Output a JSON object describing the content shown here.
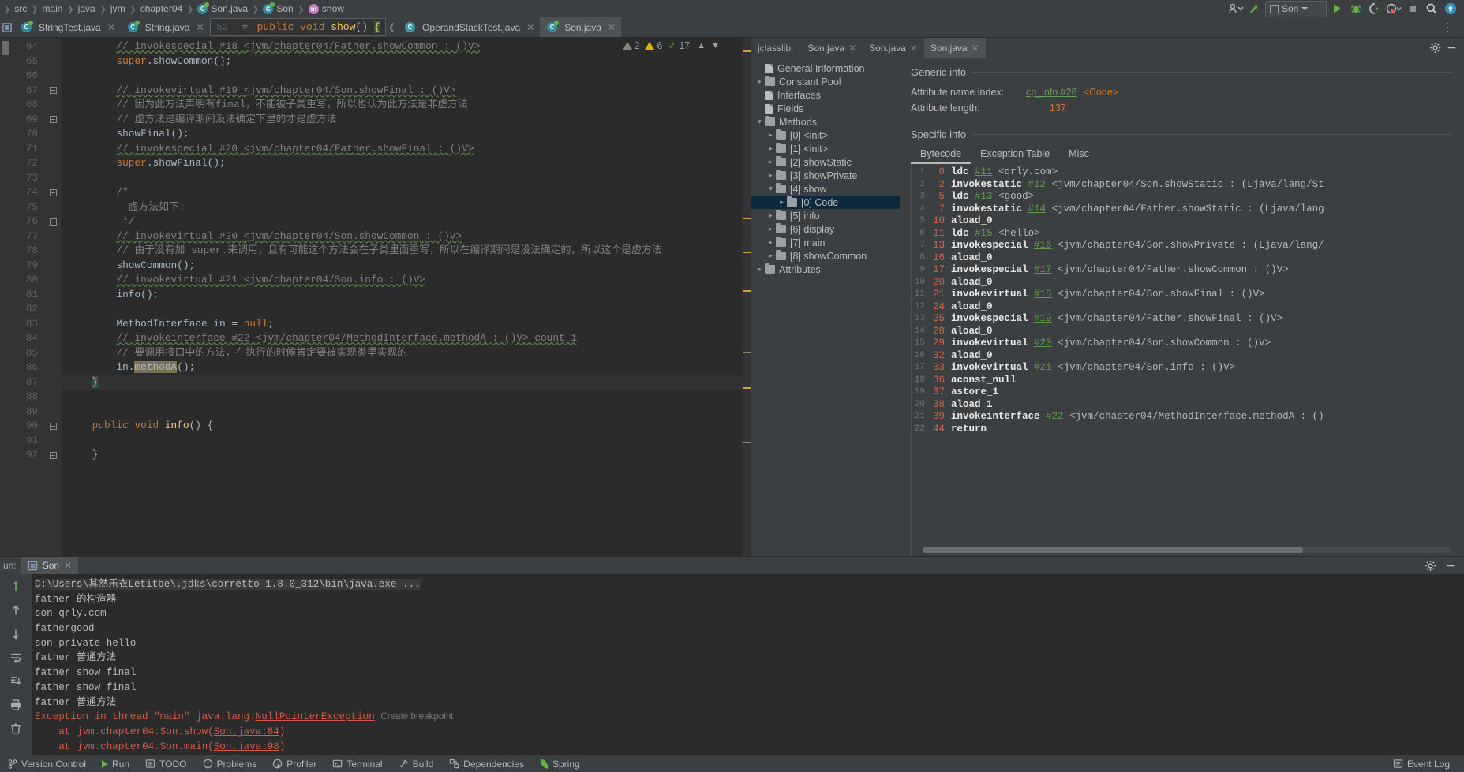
{
  "navbar": {
    "breadcrumbs": [
      {
        "label": "src",
        "icon": "none"
      },
      {
        "label": "main",
        "icon": "none"
      },
      {
        "label": "java",
        "icon": "none"
      },
      {
        "label": "jvm",
        "icon": "none"
      },
      {
        "label": "chapter04",
        "icon": "none"
      },
      {
        "label": "Son.java",
        "icon": "class-icon"
      },
      {
        "label": "Son",
        "icon": "class-icon"
      },
      {
        "label": "show",
        "icon": "method-icon"
      }
    ],
    "run_config": "Son",
    "buttons": {
      "profile": "user-dropdown-icon",
      "updates": "update-arrow-icon",
      "run": "run-icon",
      "debug": "debug-icon",
      "coverage": "run-with-coverage-icon",
      "profiler": "profiler-icon",
      "stop": "stop-icon",
      "search": "search-icon",
      "notifications": "notifications-icon"
    }
  },
  "editor": {
    "tabs": [
      {
        "label": "StringTest.java",
        "icon": "java-class-icon",
        "active": false,
        "closable": true
      },
      {
        "label": "String.java",
        "icon": "java-class-icon",
        "active": false,
        "closable": true
      },
      {
        "label": "OperandStackTest.java",
        "icon": "java-interface-icon",
        "active": false,
        "closable": true
      },
      {
        "label": "Son.java",
        "icon": "java-class-icon",
        "active": true,
        "closable": true
      }
    ],
    "breadcrumb_inline": {
      "line_number": "52",
      "signature_prefix": "public void show() ",
      "signature_brace": "{"
    },
    "inspections": {
      "gray_count": "2",
      "warn_count": "6",
      "ok_count": "17",
      "up_arrow": "chevron-up-icon",
      "down_arrow": "chevron-down-icon"
    },
    "first_line": 64,
    "current_line": 87,
    "lines": [
      {
        "n": 64,
        "fold": "",
        "tokens": [
          {
            "t": "comment-wavy",
            "s": "// invokespecial #18 <jvm/chapter04/Father.showCommon : ()V>",
            "indent": 8
          }
        ]
      },
      {
        "n": 65,
        "fold": "",
        "tokens": [
          {
            "t": "kw",
            "s": "super",
            "indent": 8
          },
          {
            "t": "plain",
            "s": ".showCommon();"
          }
        ]
      },
      {
        "n": 66,
        "fold": "",
        "tokens": []
      },
      {
        "n": 67,
        "fold": "fold-open",
        "tokens": [
          {
            "t": "comment-wavy",
            "s": "// invokevirtual #19 <jvm/chapter04/Son.showFinal : ()V>",
            "indent": 8
          }
        ]
      },
      {
        "n": 68,
        "fold": "",
        "tokens": [
          {
            "t": "comment",
            "s": "// 因为此方法声明有final，不能被子类重写，所以也认为此方法是非虚方法",
            "indent": 8
          }
        ]
      },
      {
        "n": 69,
        "fold": "fold-close",
        "tokens": [
          {
            "t": "comment",
            "s": "// 虚方法是编译期间没法确定下里的才是虚方法",
            "indent": 8
          }
        ]
      },
      {
        "n": 70,
        "fold": "",
        "tokens": [
          {
            "t": "plain",
            "s": "showFinal();",
            "indent": 8
          }
        ]
      },
      {
        "n": 71,
        "fold": "",
        "tokens": [
          {
            "t": "comment-wavy",
            "s": "// invokespecial #20 <jvm/chapter04/Father.showFinal : ()V>",
            "indent": 8
          }
        ]
      },
      {
        "n": 72,
        "fold": "",
        "tokens": [
          {
            "t": "kw",
            "s": "super",
            "indent": 8
          },
          {
            "t": "plain",
            "s": ".showFinal();"
          }
        ]
      },
      {
        "n": 73,
        "fold": "",
        "tokens": []
      },
      {
        "n": 74,
        "fold": "fold-open",
        "tokens": [
          {
            "t": "comment",
            "s": "/*",
            "indent": 8
          }
        ]
      },
      {
        "n": 75,
        "fold": "",
        "tokens": [
          {
            "t": "comment",
            "s": "  虚方法如下:",
            "indent": 8
          }
        ]
      },
      {
        "n": 76,
        "fold": "fold-close",
        "tokens": [
          {
            "t": "comment",
            "s": " */",
            "indent": 8
          }
        ]
      },
      {
        "n": 77,
        "fold": "",
        "tokens": [
          {
            "t": "comment-wavy",
            "s": "// invokevirtual #20 <jvm/chapter04/Son.showCommon : ()V>",
            "indent": 8
          }
        ]
      },
      {
        "n": 78,
        "fold": "",
        "tokens": [
          {
            "t": "comment",
            "s": "// 由于没有加 super.来调用，且有可能这个方法会在子类里面重写，所以在编译期间是没法确定的，所以这个是虚方法",
            "indent": 8
          }
        ]
      },
      {
        "n": 79,
        "fold": "",
        "tokens": [
          {
            "t": "plain",
            "s": "showCommon();",
            "indent": 8
          }
        ]
      },
      {
        "n": 80,
        "fold": "",
        "tokens": [
          {
            "t": "comment-wavy",
            "s": "// invokevirtual #21 <jvm/chapter04/Son.info : ()V>",
            "indent": 8
          }
        ]
      },
      {
        "n": 81,
        "fold": "",
        "tokens": [
          {
            "t": "plain",
            "s": "info();",
            "indent": 8
          }
        ]
      },
      {
        "n": 82,
        "fold": "",
        "tokens": []
      },
      {
        "n": 83,
        "fold": "",
        "tokens": [
          {
            "t": "plain",
            "s": "MethodInterface in = ",
            "indent": 8
          },
          {
            "t": "kw",
            "s": "null"
          },
          {
            "t": "plain",
            "s": ";"
          }
        ]
      },
      {
        "n": 84,
        "fold": "",
        "tokens": [
          {
            "t": "comment-wavy",
            "s": "// invokeinterface #22 <jvm/chapter04/MethodInterface.methodA : ()V> count 1",
            "indent": 8
          }
        ]
      },
      {
        "n": 85,
        "fold": "",
        "tokens": [
          {
            "t": "comment",
            "s": "// 要调用接口中的方法，在执行的时候肯定要被实现类里实现的",
            "indent": 8
          }
        ]
      },
      {
        "n": 86,
        "fold": "",
        "tokens": [
          {
            "t": "plain",
            "s": "in.",
            "indent": 8
          },
          {
            "t": "selected",
            "s": "methodA"
          },
          {
            "t": "plain",
            "s": "();"
          }
        ]
      },
      {
        "n": 87,
        "fold": "",
        "tokens": [
          {
            "t": "brace-hl",
            "s": "}",
            "indent": 4
          }
        ]
      },
      {
        "n": 88,
        "fold": "",
        "tokens": []
      },
      {
        "n": 89,
        "fold": "",
        "tokens": []
      },
      {
        "n": 90,
        "fold": "fold-open",
        "tokens": [
          {
            "t": "kw",
            "s": "public void ",
            "indent": 4
          },
          {
            "t": "mth",
            "s": "info"
          },
          {
            "t": "plain",
            "s": "() {"
          }
        ]
      },
      {
        "n": 91,
        "fold": "",
        "tokens": []
      },
      {
        "n": 92,
        "fold": "fold-close",
        "tokens": [
          {
            "t": "plain",
            "s": "}",
            "indent": 4
          }
        ]
      }
    ]
  },
  "jclasslib": {
    "header_label": "jclasslib:",
    "tabs": [
      {
        "label": "Son.java",
        "active": false
      },
      {
        "label": "Son.java",
        "active": false
      },
      {
        "label": "Son.java",
        "active": true
      }
    ],
    "settings_icon": "gear-icon",
    "minimize_icon": "minimize-icon",
    "tree": [
      {
        "label": "General Information",
        "type": "file",
        "depth": 0,
        "arrow": "",
        "selected": false
      },
      {
        "label": "Constant Pool",
        "type": "folder",
        "depth": 0,
        "arrow": "collapsed",
        "selected": false
      },
      {
        "label": "Interfaces",
        "type": "file",
        "depth": 0,
        "arrow": "",
        "selected": false
      },
      {
        "label": "Fields",
        "type": "file",
        "depth": 0,
        "arrow": "",
        "selected": false
      },
      {
        "label": "Methods",
        "type": "folder",
        "depth": 0,
        "arrow": "expanded",
        "selected": false
      },
      {
        "label": "[0] <init>",
        "type": "folder",
        "depth": 1,
        "arrow": "collapsed",
        "selected": false
      },
      {
        "label": "[1] <init>",
        "type": "folder",
        "depth": 1,
        "arrow": "collapsed",
        "selected": false
      },
      {
        "label": "[2] showStatic",
        "type": "folder",
        "depth": 1,
        "arrow": "collapsed",
        "selected": false
      },
      {
        "label": "[3] showPrivate",
        "type": "folder",
        "depth": 1,
        "arrow": "collapsed",
        "selected": false
      },
      {
        "label": "[4] show",
        "type": "folder",
        "depth": 1,
        "arrow": "expanded",
        "selected": false
      },
      {
        "label": "[0] Code",
        "type": "folder",
        "depth": 2,
        "arrow": "collapsed",
        "selected": true
      },
      {
        "label": "[5] info",
        "type": "folder",
        "depth": 1,
        "arrow": "collapsed",
        "selected": false
      },
      {
        "label": "[6] display",
        "type": "folder",
        "depth": 1,
        "arrow": "collapsed",
        "selected": false
      },
      {
        "label": "[7] main",
        "type": "folder",
        "depth": 1,
        "arrow": "collapsed",
        "selected": false
      },
      {
        "label": "[8] showCommon",
        "type": "folder",
        "depth": 1,
        "arrow": "collapsed",
        "selected": false
      },
      {
        "label": "Attributes",
        "type": "folder",
        "depth": 0,
        "arrow": "collapsed",
        "selected": false
      }
    ],
    "generic_info": {
      "title": "Generic info",
      "attribute_name_index_label": "Attribute name index:",
      "attribute_name_index_link": "cp_info #28",
      "attribute_name_index_value": "<Code>",
      "attribute_length_label": "Attribute length:",
      "attribute_length_value": "137"
    },
    "specific_info": {
      "title": "Specific info",
      "tabs": [
        {
          "label": "Bytecode",
          "active": true
        },
        {
          "label": "Exception Table",
          "active": false
        },
        {
          "label": "Misc",
          "active": false
        }
      ]
    },
    "bytecode": [
      {
        "idx": "1",
        "offset": "0",
        "op": "ldc",
        "ref": "#11",
        "arg": "<qrly.com>"
      },
      {
        "idx": "2",
        "offset": "2",
        "op": "invokestatic",
        "ref": "#12",
        "arg": "<jvm/chapter04/Son.showStatic : (Ljava/lang/St"
      },
      {
        "idx": "3",
        "offset": "5",
        "op": "ldc",
        "ref": "#13",
        "arg": "<good>"
      },
      {
        "idx": "4",
        "offset": "7",
        "op": "invokestatic",
        "ref": "#14",
        "arg": "<jvm/chapter04/Father.showStatic : (Ljava/lang"
      },
      {
        "idx": "5",
        "offset": "10",
        "op": "aload_0",
        "ref": "",
        "arg": ""
      },
      {
        "idx": "6",
        "offset": "11",
        "op": "ldc",
        "ref": "#15",
        "arg": "<hello>"
      },
      {
        "idx": "7",
        "offset": "13",
        "op": "invokespecial",
        "ref": "#16",
        "arg": "<jvm/chapter04/Son.showPrivate : (Ljava/lang/"
      },
      {
        "idx": "8",
        "offset": "16",
        "op": "aload_0",
        "ref": "",
        "arg": ""
      },
      {
        "idx": "9",
        "offset": "17",
        "op": "invokespecial",
        "ref": "#17",
        "arg": "<jvm/chapter04/Father.showCommon : ()V>"
      },
      {
        "idx": "10",
        "offset": "20",
        "op": "aload_0",
        "ref": "",
        "arg": ""
      },
      {
        "idx": "11",
        "offset": "21",
        "op": "invokevirtual",
        "ref": "#18",
        "arg": "<jvm/chapter04/Son.showFinal : ()V>"
      },
      {
        "idx": "12",
        "offset": "24",
        "op": "aload_0",
        "ref": "",
        "arg": ""
      },
      {
        "idx": "13",
        "offset": "25",
        "op": "invokespecial",
        "ref": "#19",
        "arg": "<jvm/chapter04/Father.showFinal : ()V>"
      },
      {
        "idx": "14",
        "offset": "28",
        "op": "aload_0",
        "ref": "",
        "arg": ""
      },
      {
        "idx": "15",
        "offset": "29",
        "op": "invokevirtual",
        "ref": "#20",
        "arg": "<jvm/chapter04/Son.showCommon : ()V>"
      },
      {
        "idx": "16",
        "offset": "32",
        "op": "aload_0",
        "ref": "",
        "arg": ""
      },
      {
        "idx": "17",
        "offset": "33",
        "op": "invokevirtual",
        "ref": "#21",
        "arg": "<jvm/chapter04/Son.info : ()V>"
      },
      {
        "idx": "18",
        "offset": "36",
        "op": "aconst_null",
        "ref": "",
        "arg": ""
      },
      {
        "idx": "19",
        "offset": "37",
        "op": "astore_1",
        "ref": "",
        "arg": ""
      },
      {
        "idx": "20",
        "offset": "38",
        "op": "aload_1",
        "ref": "",
        "arg": ""
      },
      {
        "idx": "21",
        "offset": "39",
        "op": "invokeinterface",
        "ref": "#22",
        "arg": "<jvm/chapter04/MethodInterface.methodA : ()"
      },
      {
        "idx": "22",
        "offset": "44",
        "op": "return",
        "ref": "",
        "arg": ""
      }
    ]
  },
  "run_panel": {
    "label": "un:",
    "tab_label": "Son",
    "tab_icon": "run-config-icon",
    "close_icon": "close-icon",
    "settings_icon": "gear-icon",
    "minimize_icon": "minimize-icon",
    "sidebar_icons": [
      "rerun-icon",
      "scroll-up-icon",
      "scroll-down-icon",
      "soft-wrap-icon",
      "scroll-to-end-icon",
      "print-icon",
      "trash-icon"
    ],
    "console": [
      {
        "type": "cmd",
        "text": "C:\\Users\\其然乐衣Letitbe\\.jdks\\corretto-1.8.0_312\\bin\\java.exe ..."
      },
      {
        "type": "out",
        "text": "father 的构造器"
      },
      {
        "type": "out",
        "text": "son qrly.com"
      },
      {
        "type": "out",
        "text": "fathergood"
      },
      {
        "type": "out",
        "text": "son private hello"
      },
      {
        "type": "out",
        "text": "father 普通方法"
      },
      {
        "type": "out",
        "text": "father show final"
      },
      {
        "type": "out",
        "text": "father show final"
      },
      {
        "type": "out",
        "text": "father 普通方法"
      },
      {
        "type": "exc",
        "text": "Exception in thread \"main\" java.lang.",
        "link": "NullPointerException",
        "hint": "Create breakpoint"
      },
      {
        "type": "at",
        "prefix": "    at jvm.chapter04.Son.show(",
        "link": "Son.java:84",
        "suffix": ")"
      },
      {
        "type": "at",
        "prefix": "    at jvm.chapter04.Son.main(",
        "link": "Son.java:98",
        "suffix": ")"
      }
    ]
  },
  "status_bar": {
    "items": [
      {
        "label": "Version Control",
        "icon": "version-control-icon"
      },
      {
        "label": "Run",
        "icon": "run-icon"
      },
      {
        "label": "TODO",
        "icon": "todo-icon"
      },
      {
        "label": "Problems",
        "icon": "problems-icon"
      },
      {
        "label": "Profiler",
        "icon": "profiler-icon"
      },
      {
        "label": "Terminal",
        "icon": "terminal-icon"
      },
      {
        "label": "Build",
        "icon": "build-icon"
      },
      {
        "label": "Dependencies",
        "icon": "dependencies-icon"
      },
      {
        "label": "Spring",
        "icon": "spring-icon"
      }
    ],
    "right": [
      {
        "label": "Event Log",
        "icon": "event-log-icon"
      }
    ]
  },
  "colors": {
    "bg_chrome": "#3c3f41",
    "bg_editor": "#2b2b2b",
    "accent_selection": "#0d293e",
    "keyword": "#cc7832",
    "comment": "#808080",
    "method": "#ffc66d",
    "error": "#d05b4b",
    "link_green": "#5f9b4d",
    "offset_red": "#d5624a"
  }
}
